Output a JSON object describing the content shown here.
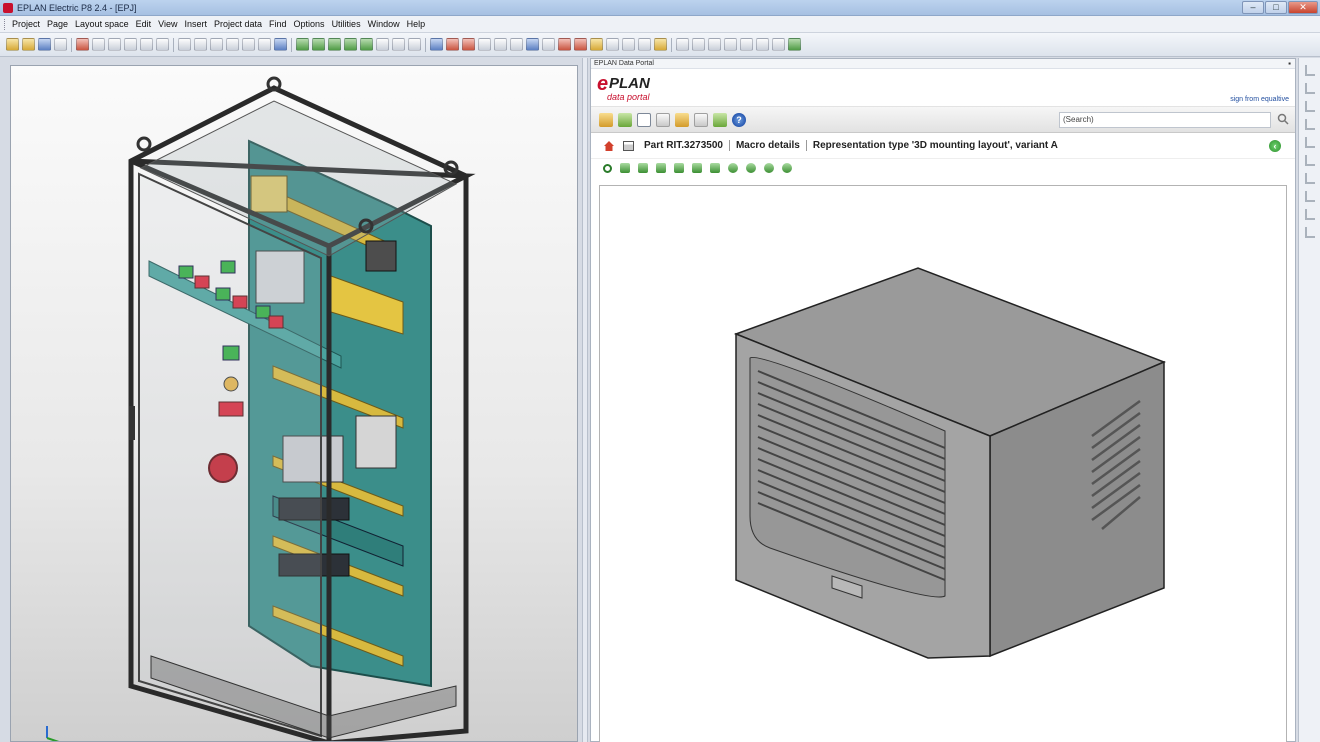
{
  "window": {
    "title": "EPLAN Electric P8 2.4 - [EPJ]"
  },
  "menu": [
    "Project",
    "Page",
    "Layout space",
    "Edit",
    "View",
    "Insert",
    "Project data",
    "Find",
    "Options",
    "Utilities",
    "Window",
    "Help"
  ],
  "portal": {
    "window_title": "EPLAN Data Portal",
    "login_link": "sign from equaltive",
    "search_placeholder": "(Search)",
    "breadcrumb": {
      "part": "Part RIT.3273500",
      "macro": "Macro details",
      "representation": "Representation type '3D mounting layout', variant A"
    }
  }
}
